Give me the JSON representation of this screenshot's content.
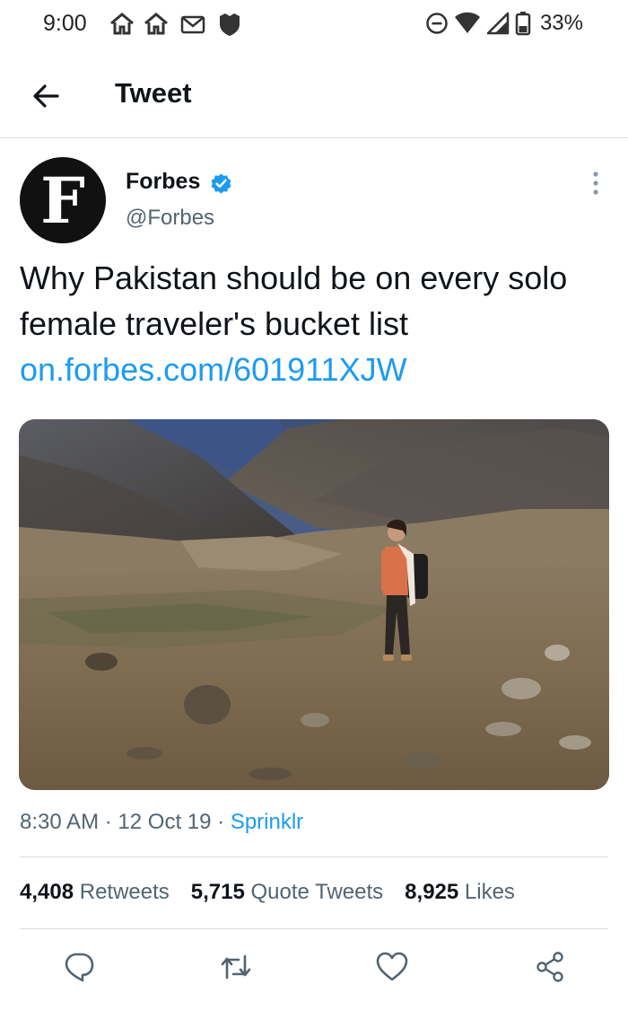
{
  "status_bar": {
    "time": "9:00",
    "left_icons": [
      "home-icon",
      "home-icon",
      "gmail-icon",
      "shield-icon"
    ],
    "right_icons": [
      "do-not-disturb-icon",
      "wifi-icon",
      "signal-icon",
      "battery-icon"
    ],
    "battery": "33%"
  },
  "header": {
    "title": "Tweet",
    "back_icon": "arrow-left-icon"
  },
  "tweet": {
    "author": {
      "avatar_letter": "F",
      "name": "Forbes",
      "handle": "@Forbes",
      "verified": true
    },
    "text": "Why Pakistan should be on every solo female traveler's bucket list",
    "link": "on.forbes.com/601911XJW",
    "time": "8:30 AM",
    "date": "12 Oct 19",
    "source": "Sprinklr",
    "separator": "·"
  },
  "stats": {
    "retweets_count": "4,408",
    "retweets_label": "Retweets",
    "quotes_count": "5,715",
    "quotes_label": "Quote Tweets",
    "likes_count": "8,925",
    "likes_label": "Likes"
  },
  "actions": [
    "reply-icon",
    "retweet-icon",
    "like-icon",
    "share-icon"
  ],
  "colors": {
    "accent": "#1d9bf0",
    "text": "#0f1419",
    "secondary": "#536471",
    "divider": "#d9dde1"
  }
}
